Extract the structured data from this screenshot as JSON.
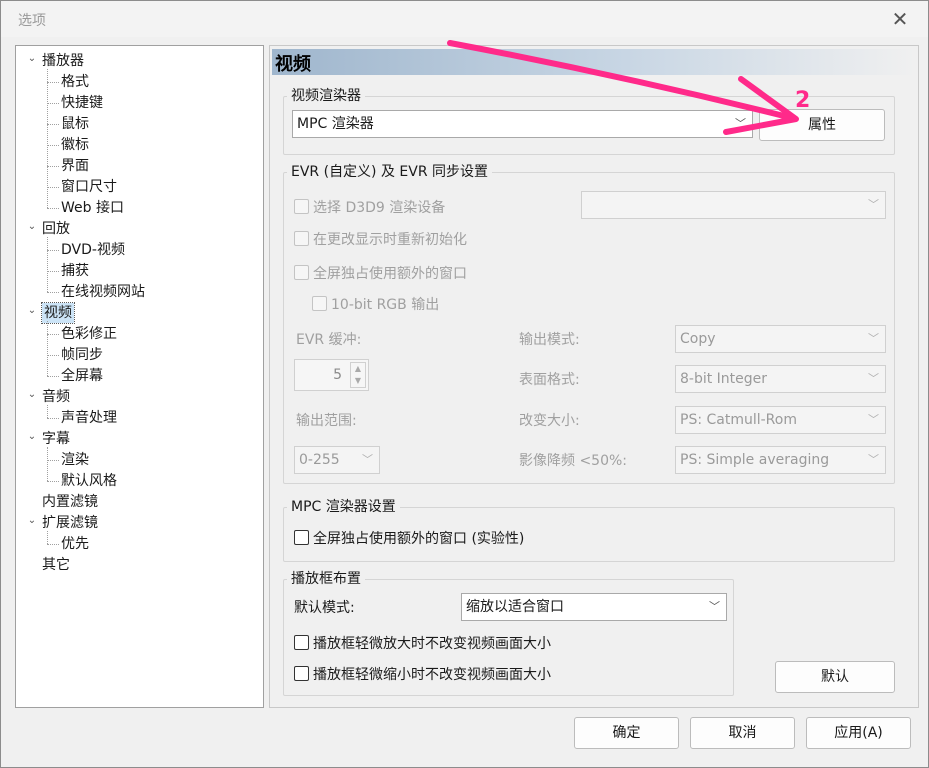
{
  "window": {
    "title": "选项",
    "close_glyph": "✕"
  },
  "tree": {
    "items": [
      {
        "label": "播放器",
        "level": 0,
        "expanded": true
      },
      {
        "label": "格式",
        "level": 1
      },
      {
        "label": "快捷键",
        "level": 1
      },
      {
        "label": "鼠标",
        "level": 1
      },
      {
        "label": "徽标",
        "level": 1
      },
      {
        "label": "界面",
        "level": 1
      },
      {
        "label": "窗口尺寸",
        "level": 1
      },
      {
        "label": "Web 接口",
        "level": 1
      },
      {
        "label": "回放",
        "level": 0,
        "expanded": true
      },
      {
        "label": "DVD-视频",
        "level": 1
      },
      {
        "label": "捕获",
        "level": 1
      },
      {
        "label": "在线视频网站",
        "level": 1
      },
      {
        "label": "视频",
        "level": 0,
        "expanded": true,
        "selected": true
      },
      {
        "label": "色彩修正",
        "level": 1
      },
      {
        "label": "帧同步",
        "level": 1
      },
      {
        "label": "全屏幕",
        "level": 1
      },
      {
        "label": "音频",
        "level": 0,
        "expanded": true
      },
      {
        "label": "声音处理",
        "level": 1
      },
      {
        "label": "字幕",
        "level": 0,
        "expanded": true
      },
      {
        "label": "渲染",
        "level": 1
      },
      {
        "label": "默认风格",
        "level": 1
      },
      {
        "label": "内置滤镜",
        "level": 0
      },
      {
        "label": "扩展滤镜",
        "level": 0,
        "expanded": true
      },
      {
        "label": "优先",
        "level": 1
      },
      {
        "label": "其它",
        "level": 0
      }
    ]
  },
  "page": {
    "title": "视频"
  },
  "renderer_group": {
    "title": "视频渲染器",
    "selected": "MPC 渲染器",
    "properties_button": "属性"
  },
  "evr_group": {
    "title": "EVR (自定义) 及 EVR 同步设置",
    "select_d3d9": "选择 D3D9 渲染设备",
    "d3d9_device": "",
    "reinit_on_display_change": "在更改显示时重新初始化",
    "fullscreen_extra_window": "全屏独占使用额外的窗口",
    "rgb_10bit": "10-bit RGB 输出",
    "evr_buffer_label": "EVR 缓冲:",
    "evr_buffer_value": "5",
    "output_range_label": "输出范围:",
    "output_range_value": "0-255",
    "output_mode_label": "输出模式:",
    "output_mode_value": "Copy",
    "surface_format_label": "表面格式:",
    "surface_format_value": "8-bit Integer",
    "resize_label": "改变大小:",
    "resize_value": "PS: Catmull-Rom",
    "downscale_label": "影像降频 <50%:",
    "downscale_value": "PS: Simple averaging"
  },
  "mpc_group": {
    "title": "MPC 渲染器设置",
    "fullscreen_extra_window": "全屏独占使用额外的窗口 (实验性)"
  },
  "frame_group": {
    "title": "播放框布置",
    "default_mode_label": "默认模式:",
    "default_mode_value": "缩放以适合窗口",
    "zoom_in_option": "播放框轻微放大时不改变视频画面大小",
    "zoom_out_option": "播放框轻微缩小时不改变视频画面大小"
  },
  "defaults_button": "默认",
  "footer": {
    "ok": "确定",
    "cancel": "取消",
    "apply": "应用(A)"
  },
  "annotation": {
    "number": "2",
    "color": "#ff2a8a"
  }
}
